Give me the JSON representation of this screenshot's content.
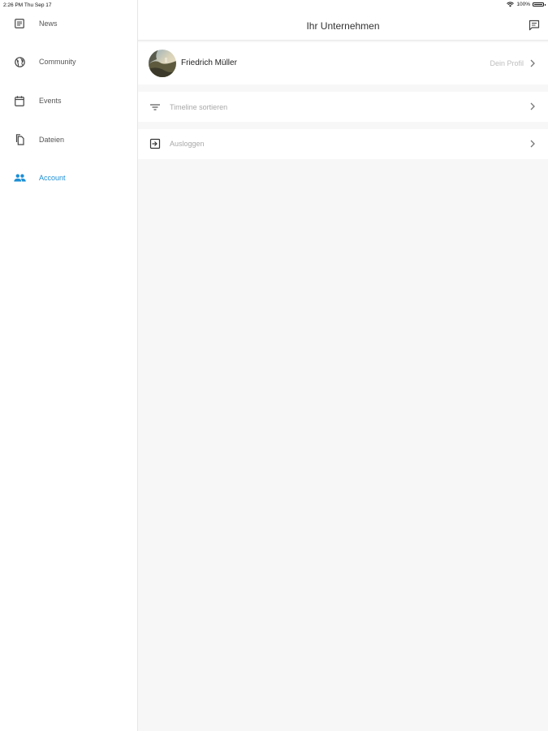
{
  "status_bar": {
    "time": "2:26 PM  Thu Sep 17",
    "battery": "100%"
  },
  "sidebar": {
    "items": [
      {
        "label": "News",
        "icon": "news-icon",
        "active": false
      },
      {
        "label": "Community",
        "icon": "globe-icon",
        "active": false
      },
      {
        "label": "Events",
        "icon": "calendar-icon",
        "active": false
      },
      {
        "label": "Dateien",
        "icon": "files-icon",
        "active": false
      },
      {
        "label": "Account",
        "icon": "people-icon",
        "active": true
      }
    ]
  },
  "header": {
    "title": "Ihr Unternehmen",
    "right_icon": "chat-icon"
  },
  "profile": {
    "name": "Friedrich Müller",
    "link": "Dein Profil"
  },
  "menu": {
    "sort_label": "Timeline sortieren",
    "logout_label": "Ausloggen"
  },
  "colors": {
    "accent": "#1d8fd6",
    "background": "#f7f7f7",
    "surface": "#ffffff"
  }
}
